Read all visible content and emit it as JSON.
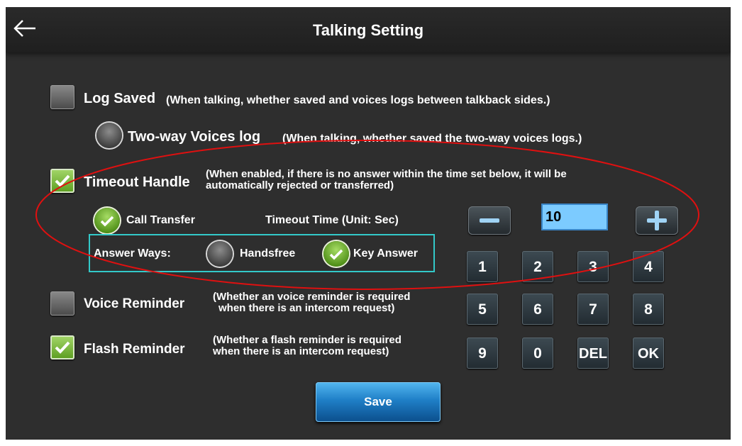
{
  "header": {
    "title": "Talking Setting",
    "back_icon": "back-arrow-icon"
  },
  "log_saved": {
    "label": "Log Saved",
    "hint": "(When talking, whether saved and voices logs between talkback sides.)",
    "checked": false
  },
  "two_way_voices_log": {
    "label": "Two-way Voices log",
    "hint": "(When talking, whether saved the two-way voices logs.)",
    "checked": false
  },
  "timeout_handle": {
    "label": "Timeout Handle",
    "hint_line1": "(When enabled, if there is no answer within the time set below, it will be",
    "hint_line2": "automatically rejected or transferred)",
    "checked": true
  },
  "call_transfer": {
    "label": "Call Transfer",
    "checked": true
  },
  "timeout_time": {
    "label": "Timeout Time (Unit: Sec)",
    "value": "10"
  },
  "answer_ways": {
    "label": "Answer Ways:",
    "options": [
      {
        "label": "Handsfree",
        "checked": false
      },
      {
        "label": "Key Answer",
        "checked": true
      }
    ]
  },
  "voice_reminder": {
    "label": "Voice Reminder",
    "hint_line1": "(Whether an voice reminder is required",
    "hint_line2": "when there is an intercom request)",
    "checked": false
  },
  "flash_reminder": {
    "label": "Flash Reminder",
    "hint_line1": "(Whether a flash reminder is required",
    "hint_line2": "when there is an intercom request)",
    "checked": true
  },
  "keypad": {
    "keys": [
      "1",
      "2",
      "3",
      "4",
      "5",
      "6",
      "7",
      "8",
      "9",
      "0",
      "DEL",
      "OK"
    ]
  },
  "save_button": {
    "label": "Save"
  },
  "colors": {
    "background": "#2e2e2e",
    "check_green": "#6fb52c",
    "input_blue": "#7ccbff",
    "save_blue": "#1f7fc7",
    "highlight_cyan": "#33c9c9",
    "annotation_red": "#e01010"
  }
}
